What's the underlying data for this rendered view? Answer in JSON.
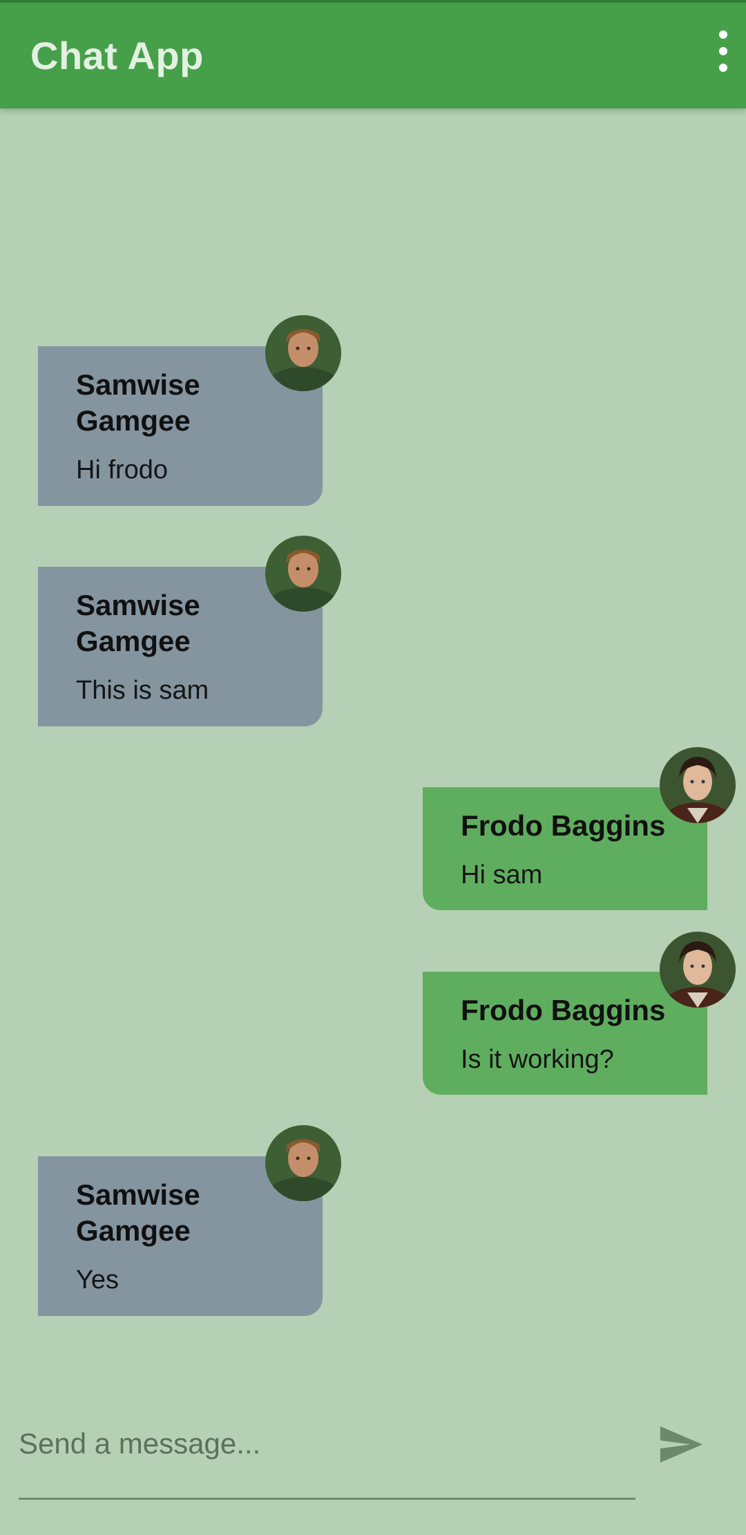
{
  "appbar": {
    "title": "Chat App",
    "menu_icon": "more-vert-icon"
  },
  "messages": [
    {
      "sender": "Samwise Gamgee",
      "text": "Hi frodo",
      "side": "left",
      "avatar": "sam-avatar"
    },
    {
      "sender": "Samwise Gamgee",
      "text": "This is sam",
      "side": "left",
      "avatar": "sam-avatar"
    },
    {
      "sender": "Frodo Baggins",
      "text": "Hi sam",
      "side": "right",
      "avatar": "frodo-avatar"
    },
    {
      "sender": "Frodo Baggins",
      "text": "Is it working?",
      "side": "right",
      "avatar": "frodo-avatar"
    },
    {
      "sender": "Samwise Gamgee",
      "text": "Yes",
      "side": "left",
      "avatar": "sam-avatar"
    }
  ],
  "composer": {
    "placeholder": "Send a message...",
    "value": "",
    "send_icon": "send-icon"
  },
  "colors": {
    "appbar": "#46a049",
    "background": "#b5d0b5",
    "received_bubble": "#8495a0",
    "sent_bubble": "#5fae5f"
  }
}
